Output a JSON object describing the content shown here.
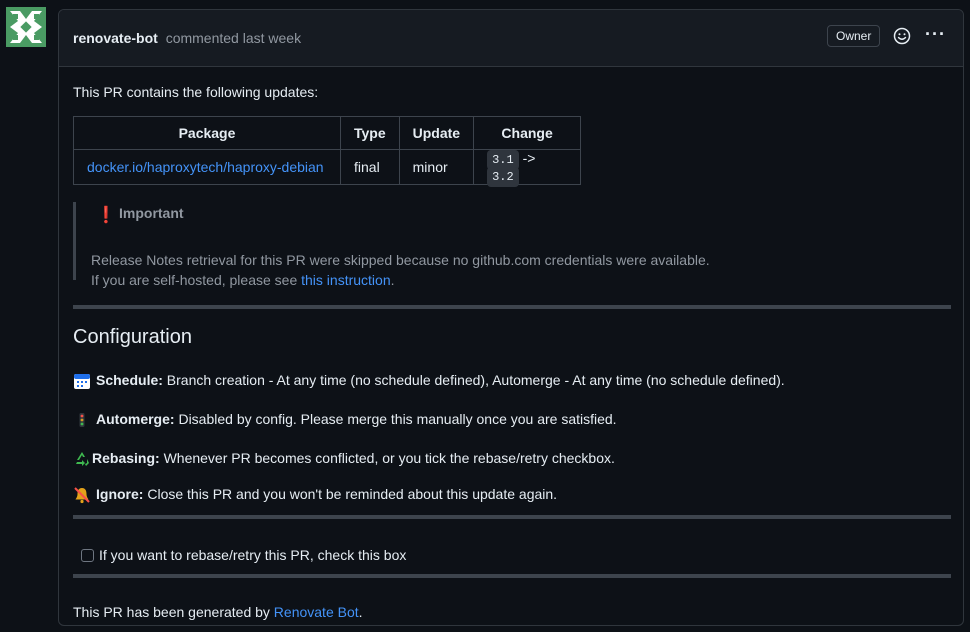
{
  "comment": {
    "author": "renovate-bot",
    "action": "commented",
    "time": "last week",
    "badge": "Owner"
  },
  "intro": "This PR contains the following updates:",
  "updates_table": {
    "headers": [
      "Package",
      "Type",
      "Update",
      "Change"
    ],
    "rows": [
      {
        "package": "docker.io/haproxytech/haproxy-debian",
        "type": "final",
        "update": "minor",
        "from": "3.1",
        "arrow": "->",
        "to": "3.2"
      }
    ]
  },
  "alert": {
    "title": "Important",
    "line1": "Release Notes retrieval for this PR were skipped because no github.com credentials were available.",
    "line2_prefix": "If you are self-hosted, please see ",
    "line2_link": "this instruction",
    "line2_suffix": "."
  },
  "configuration": {
    "heading": "Configuration",
    "items": [
      {
        "icon": "calendar-icon",
        "label": "Schedule:",
        "text": " Branch creation - At any time (no schedule defined), Automerge - At any time (no schedule defined)."
      },
      {
        "icon": "traffic-light-icon",
        "label": "Automerge:",
        "text": " Disabled by config. Please merge this manually once you are satisfied."
      },
      {
        "icon": "recycle-icon",
        "label": "Rebasing:",
        "text": " Whenever PR becomes conflicted, or you tick the rebase/retry checkbox."
      },
      {
        "icon": "muted-bell-icon",
        "label": "Ignore:",
        "text": " Close this PR and you won't be reminded about this update again."
      }
    ]
  },
  "rebase_checkbox": {
    "label": "If you want to rebase/retry this PR, check this box",
    "checked": false
  },
  "footer": {
    "prefix": "This PR has been generated by ",
    "link": "Renovate Bot",
    "suffix": "."
  },
  "colors": {
    "link": "#4493f8",
    "alert_icon": "#f85149",
    "background": "#0d1117",
    "border": "#30363d"
  }
}
